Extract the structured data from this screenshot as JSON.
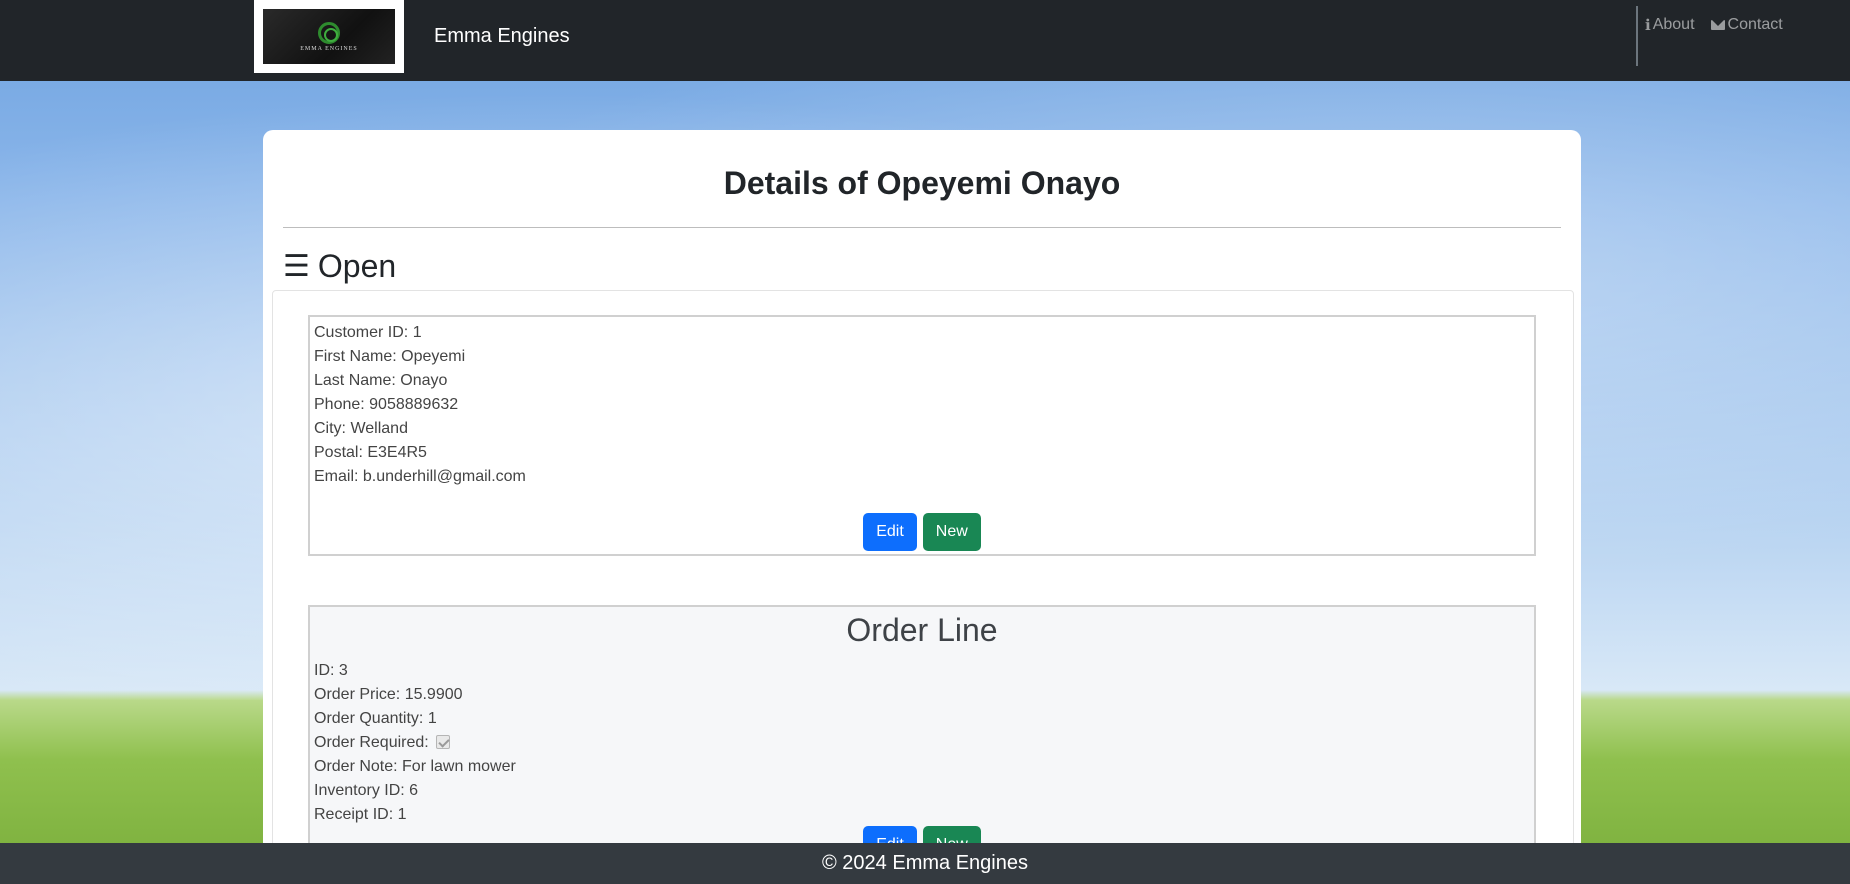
{
  "navbar": {
    "brand": "Emma Engines",
    "logo_text": "EMMA ENGINES",
    "links": [
      {
        "icon": "info-icon",
        "label": "About"
      },
      {
        "icon": "envelope-icon",
        "label": "Contact"
      }
    ]
  },
  "page": {
    "title": "Details of Opeyemi Onayo",
    "toggle_label": "Open",
    "toggle_icon": "hamburger-icon"
  },
  "customer": {
    "fields": [
      "Customer ID: 1",
      "First Name: Opeyemi",
      "Last Name: Onayo",
      "Phone: 9058889632",
      "City: Welland",
      "Postal: E3E4R5",
      "Email: b.underhill@gmail.com"
    ],
    "edit_label": "Edit",
    "new_label": "New"
  },
  "order_line": {
    "title": "Order Line",
    "id": "ID: 3",
    "price": "Order Price: 15.9900",
    "quantity": "Order Quantity: 1",
    "required_label": "Order Required:",
    "required_checked": true,
    "note": "Order Note: For lawn mower",
    "inventory_id": "Inventory ID: 6",
    "receipt_id": "Receipt ID: 1",
    "edit_label": "Edit",
    "new_label": "New"
  },
  "footer": {
    "text": "© 2024 Emma Engines"
  },
  "colors": {
    "navbar": "#212529",
    "footer": "#343a40",
    "primary": "#0d6efd",
    "success": "#198754"
  }
}
